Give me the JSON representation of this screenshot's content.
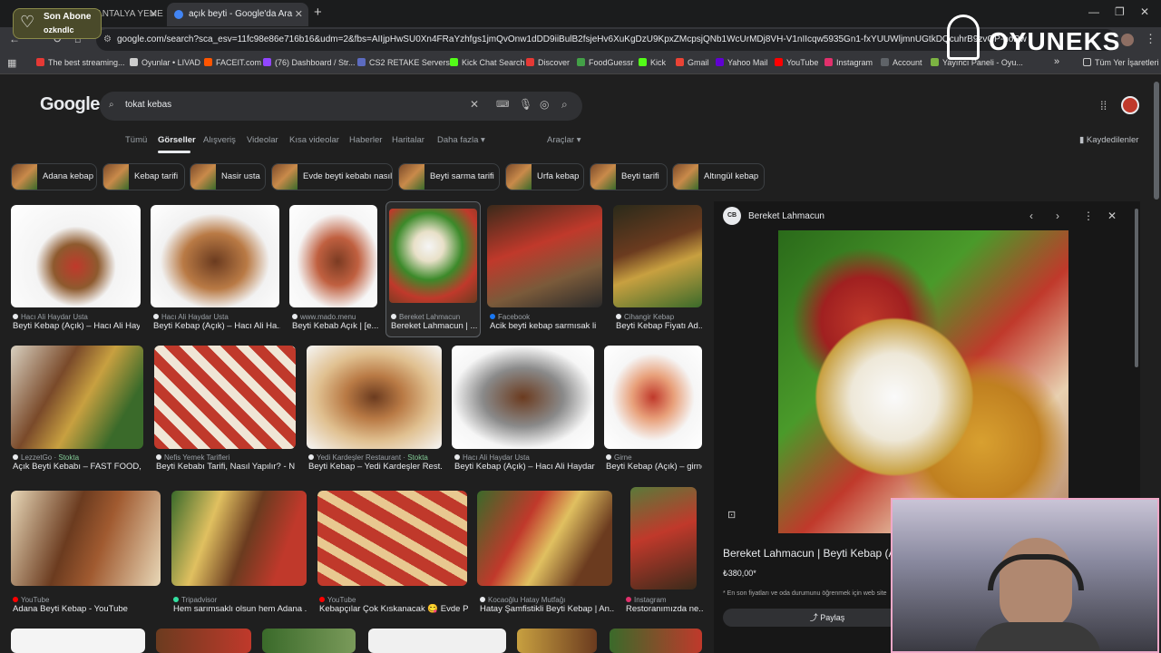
{
  "browser": {
    "tabs": [
      {
        "title": "TAHERINE ANTALYA YEMEK T...",
        "active": false
      },
      {
        "title": "açık beyti - Google'da Ara",
        "active": true
      }
    ],
    "url": "google.com/search?sca_esv=11fc98e86e716b16&udm=2&fbs=AIIjpHwSU0Xn4FRaYzhfgs1jmQvOnw1dDD9iiBulB2fsjeHv6XuKgDzU9KpxZMcpsjQNb1WcUrMDj8VH-V1nIIcqw5935Gn1-fxYUUWljmnUGtkDQcuhrB9zvGP-hoRw",
    "bookmarks": [
      {
        "label": "The best streaming...",
        "color": "#e53935"
      },
      {
        "label": "Oyunlar • LIVAD",
        "color": "#cccccc"
      },
      {
        "label": "FACEIT.com",
        "color": "#ff5500"
      },
      {
        "label": "(76) Dashboard / Str...",
        "color": "#9146ff"
      },
      {
        "label": "CS2 RETAKE Servers...",
        "color": "#5c6bc0"
      },
      {
        "label": "Kick Chat Search",
        "color": "#53fc18"
      },
      {
        "label": "Discover",
        "color": "#e53935"
      },
      {
        "label": "FoodGuessr",
        "color": "#43a047"
      },
      {
        "label": "Kick",
        "color": "#53fc18"
      },
      {
        "label": "Gmail",
        "color": "#ea4335"
      },
      {
        "label": "Yahoo Mail",
        "color": "#6001d2"
      },
      {
        "label": "YouTube",
        "color": "#ff0000"
      },
      {
        "label": "Instagram",
        "color": "#e1306c"
      },
      {
        "label": "Account",
        "color": "#5f6368"
      },
      {
        "label": "Yayıncı Paneli - Oyu...",
        "color": "#7cb342"
      }
    ],
    "all_bookmarks": "Tüm Yer İşaretleri"
  },
  "search": {
    "logo": "Google",
    "query": "tokat kebas",
    "filters": [
      "Tümü",
      "Görseller",
      "Alışveriş",
      "Videolar",
      "Kısa videolar",
      "Haberler",
      "Haritalar",
      "Daha fazla",
      "Araçlar"
    ],
    "active_filter": "Görseller",
    "saved": "Kaydedilenler",
    "chips": [
      "Adana kebap",
      "Kebap tarifi",
      "Nasir usta",
      "Evde beyti kebabı nasıl",
      "Beyti sarma tarifi",
      "Urfa kebap",
      "Beyti tarifi",
      "Altıngül kebap"
    ]
  },
  "results": {
    "row1": [
      {
        "source": "Hacı Ali Haydar Usta",
        "caption": "Beyti Kebap (Açık) – Hacı Ali Hay...",
        "stokta": ""
      },
      {
        "source": "Hacı Ali Haydar Usta",
        "caption": "Beyti Kebap (Açık) – Hacı Ali Ha...",
        "stokta": ""
      },
      {
        "source": "www.mado.menu",
        "caption": "Beyti Kebab Açık | [e...",
        "stokta": ""
      },
      {
        "source": "Bereket Lahmacun",
        "caption": "Bereket Lahmacun | ...",
        "stokta": ""
      },
      {
        "source": "Facebook",
        "caption": "Acik beyti kebap sarmısak li",
        "stokta": ""
      },
      {
        "source": "Cihangir Kebap",
        "caption": "Beyti Kebap Fiyatı Ad...",
        "stokta": ""
      }
    ],
    "row2": [
      {
        "source": "LezzetGo",
        "caption": "Açık Beyti Kebabı – FAST FOOD, ...",
        "stokta": "Stokta"
      },
      {
        "source": "Nefis Yemek Tarifleri",
        "caption": "Beyti Kebabı Tarifi, Nasıl Yapılır? - N...",
        "stokta": ""
      },
      {
        "source": "Yedi Kardeşler Restaurant",
        "caption": "Beyti Kebap – Yedi Kardeşler Rest...",
        "stokta": "Stokta"
      },
      {
        "source": "Hacı Ali Haydar Usta",
        "caption": "Beyti Kebap (Açık) – Hacı Ali Haydar...",
        "stokta": ""
      },
      {
        "source": "Girne",
        "caption": "Beyti Kebap (Açık) – girne",
        "stokta": ""
      }
    ],
    "row3": [
      {
        "source": "YouTube",
        "caption": "Adana Beyti Kebap - YouTube",
        "stokta": ""
      },
      {
        "source": "Tripadvisor",
        "caption": "Hem sarımsaklı olsun hem Adana ...",
        "stokta": ""
      },
      {
        "source": "YouTube",
        "caption": "Kebapçılar Çok Kıskanacak 😋 Evde P...",
        "stokta": ""
      },
      {
        "source": "Kocaoğlu Hatay Mutfağı",
        "caption": "Hatay Şamfistikli Beyti Kebap | An...",
        "stokta": ""
      },
      {
        "source": "Instagram",
        "caption": "Restoranımızda ne...",
        "stokta": ""
      }
    ]
  },
  "panel": {
    "logo": "CB",
    "source": "Bereket Lahmacun",
    "title": "Bereket Lahmacun | Beyti Kebap (Açık",
    "price": "₺380,00*",
    "note": "* En son fiyatları ve oda durumunu öğrenmek için web site",
    "share": "Paylaş"
  },
  "overlay": {
    "sub_label": "Son Abone",
    "sub_name": "ozkndlc",
    "brand": "OYUNEKS"
  }
}
